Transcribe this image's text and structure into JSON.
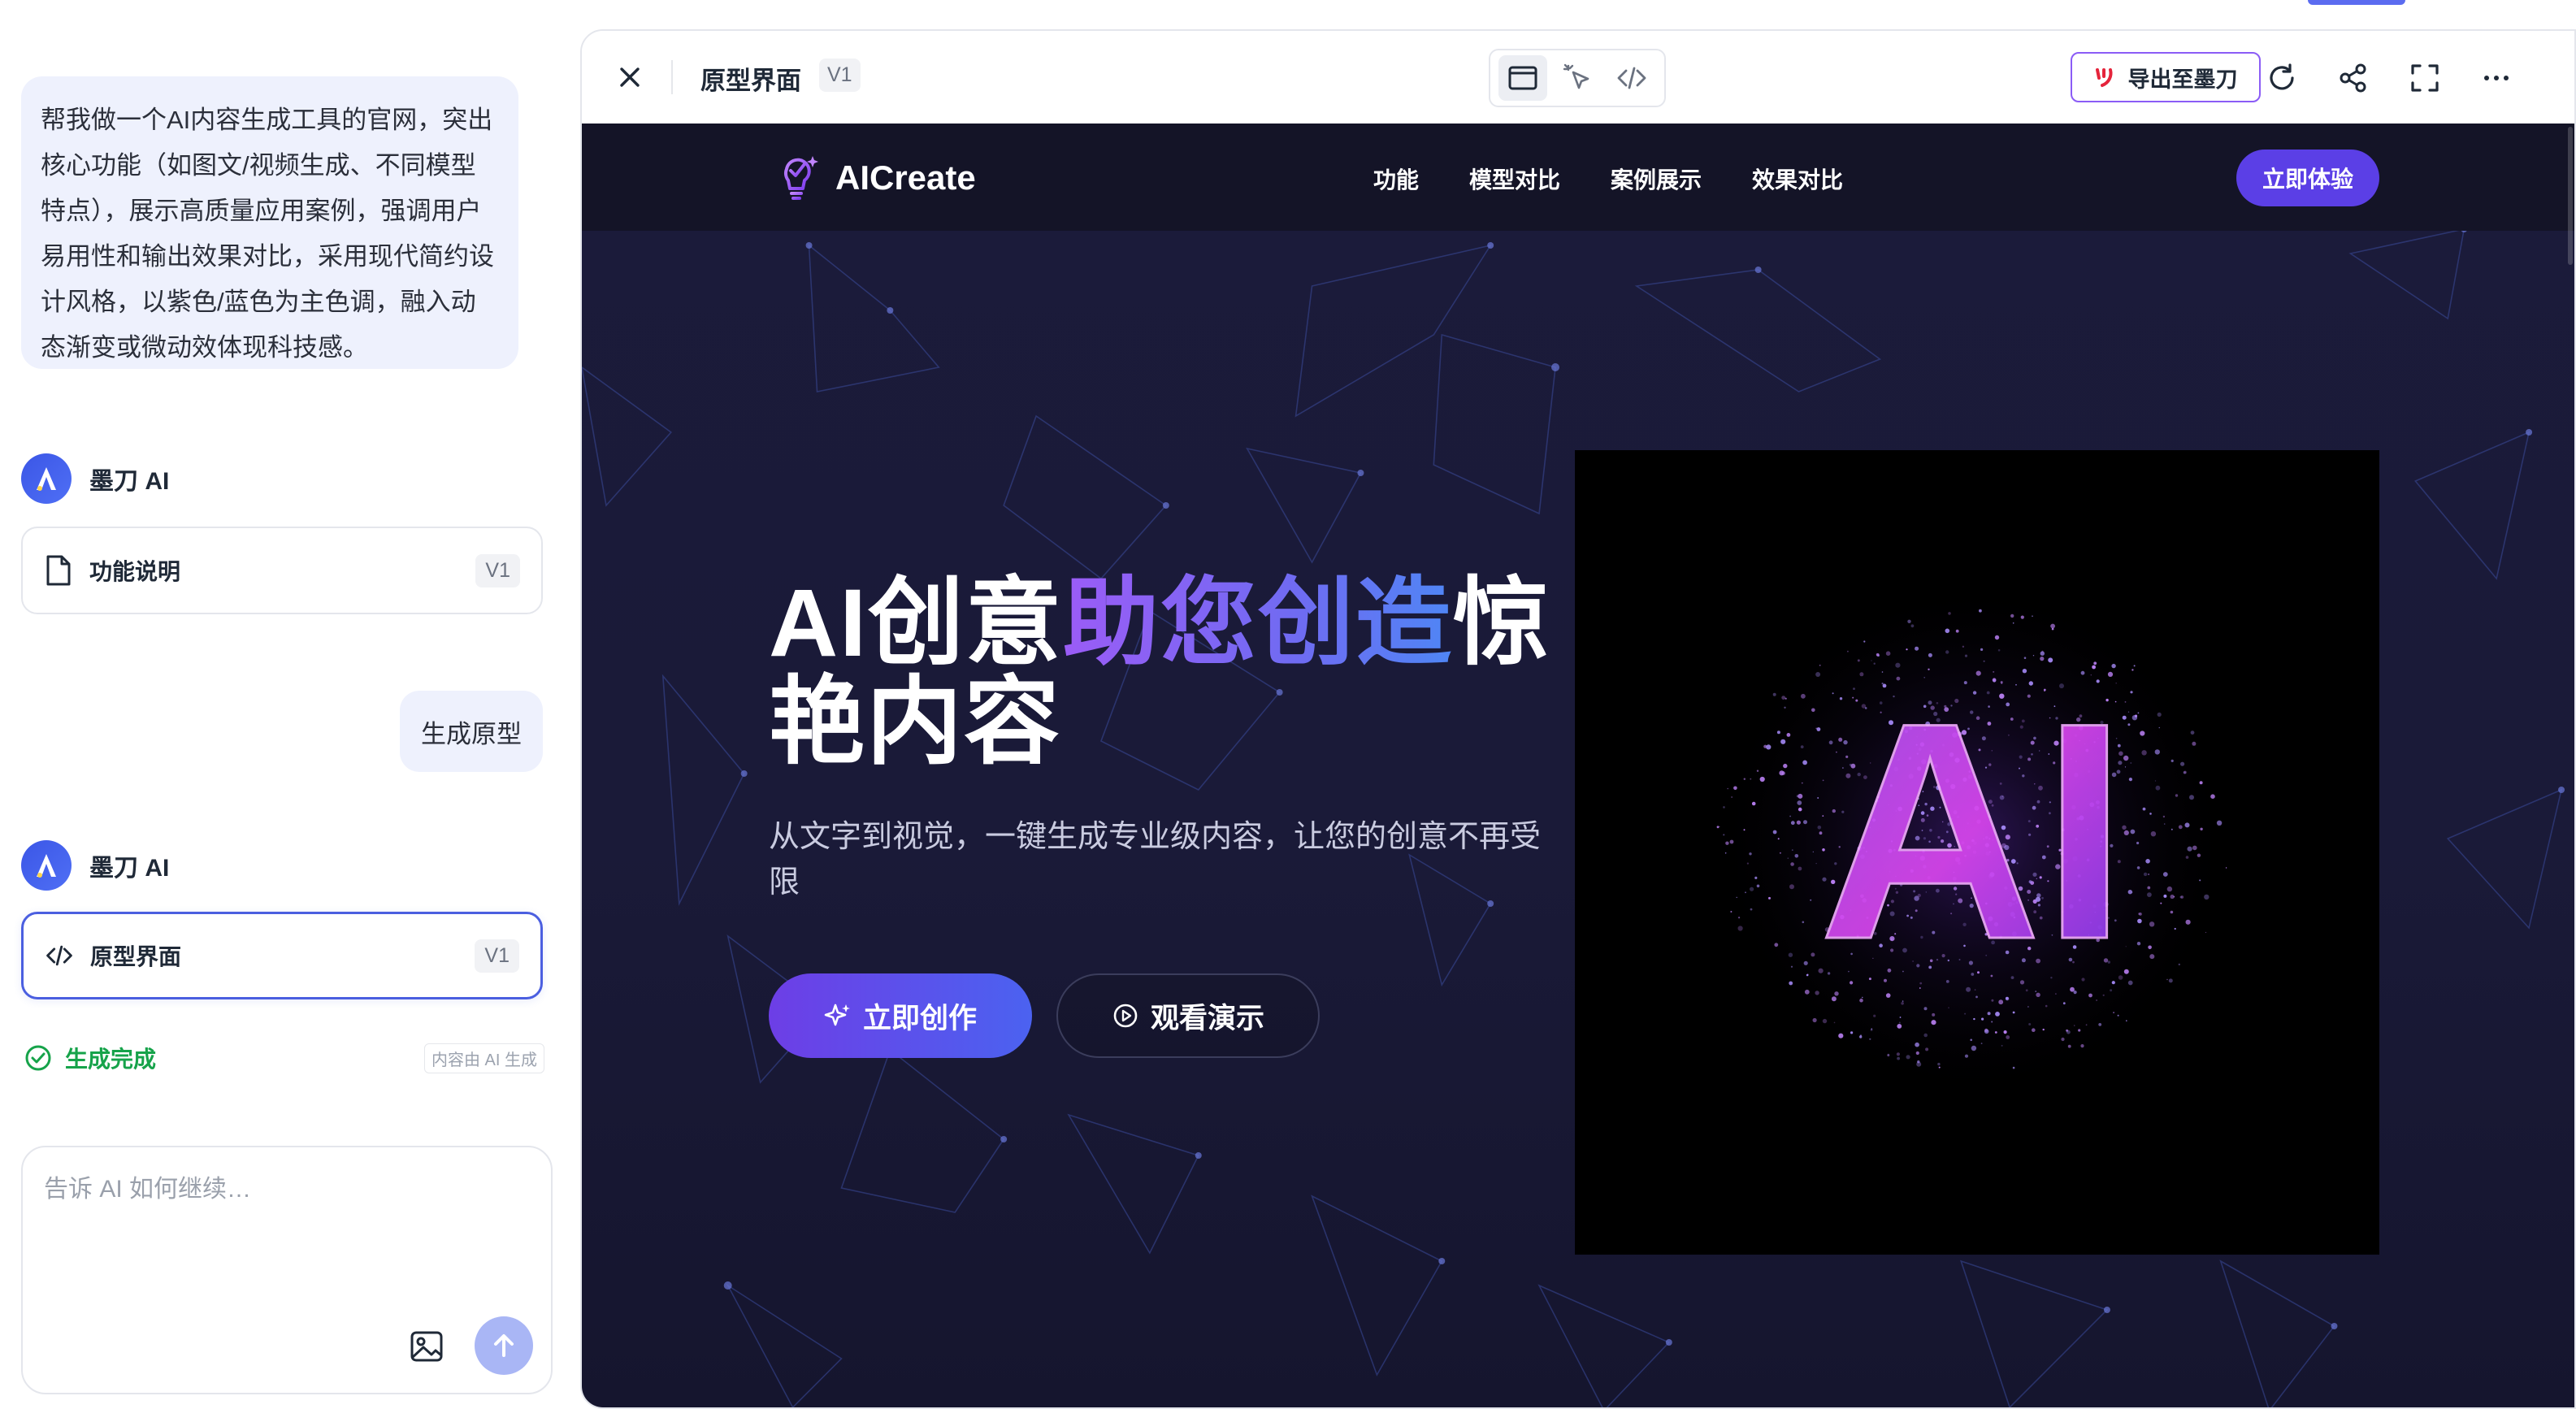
{
  "chat": {
    "prompt": "帮我做一个AI内容生成工具的官网，突出核心功能（如图文/视频生成、不同模型特点），展示高质量应用案例，强调用户易用性和输出效果对比，采用现代简约设计风格，以紫色/蓝色为主色调，融入动态渐变或微动效体现科技感。",
    "ai_name": "墨刀 AI",
    "doc_card_1": {
      "title": "功能说明",
      "version": "V1",
      "icon": "document-icon"
    },
    "user_message": "生成原型",
    "doc_card_2": {
      "title": "原型界面",
      "version": "V1",
      "icon": "code-icon"
    },
    "status": "生成完成",
    "ai_note": "内容由 AI 生成",
    "input_placeholder": "告诉 AI 如何继续…"
  },
  "toolbar": {
    "title": "原型界面",
    "version": "V1",
    "export_label": "导出至墨刀",
    "modes": [
      "preview-icon",
      "cursor-icon",
      "code-icon"
    ],
    "actions": [
      "refresh-icon",
      "share-icon",
      "fullscreen-icon",
      "more-icon"
    ]
  },
  "site": {
    "logo_text": "AICreate",
    "nav": [
      "功能",
      "模型对比",
      "案例展示",
      "效果对比"
    ],
    "nav_cta": "立即体验",
    "hero_title_a": "AI创意",
    "hero_title_b": "助您创造",
    "hero_title_c": "惊艳内容",
    "hero_sub": "从文字到视觉，一键生成专业级内容，让您的创意不再受限",
    "btn_primary": "立即创作",
    "btn_secondary": "观看演示",
    "hero_image_text": "AI"
  },
  "colors": {
    "accent": "#4b5fe0",
    "brand_purple": "#5b3fe6",
    "site_bg": "#1b1b3a",
    "status_green": "#16a34a"
  }
}
